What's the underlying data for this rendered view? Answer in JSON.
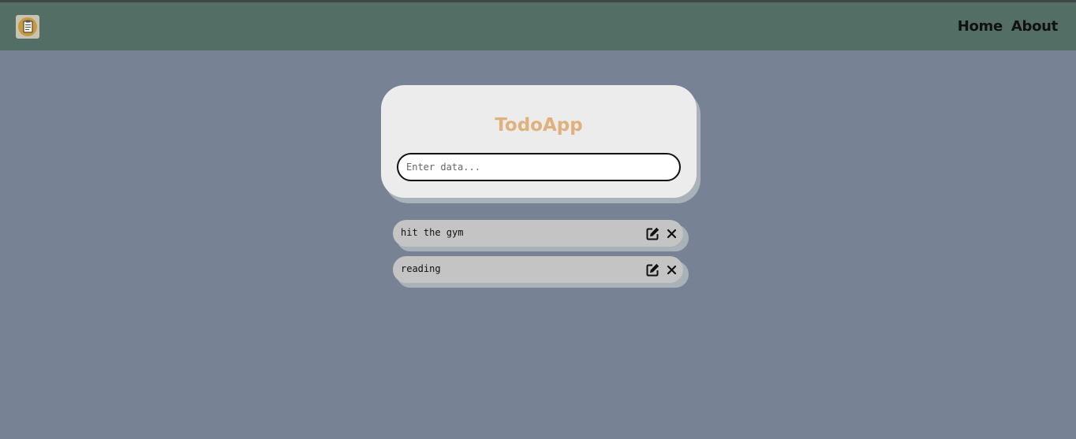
{
  "nav": {
    "logo_icon": "clipboard-icon",
    "links": [
      {
        "label": "Home"
      },
      {
        "label": "About"
      }
    ]
  },
  "card": {
    "title": "TodoApp",
    "input": {
      "placeholder": "Enter data...",
      "value": ""
    }
  },
  "todos": [
    {
      "text": "hit the gym",
      "edit_icon": "edit-icon",
      "delete_icon": "close-icon"
    },
    {
      "text": "reading",
      "edit_icon": "edit-icon",
      "delete_icon": "close-icon"
    }
  ],
  "colors": {
    "navbar": "#536e64",
    "background": "#778394",
    "title": "#e0b07d",
    "card": "#ececec",
    "todo_item": "#c4c4c4"
  }
}
